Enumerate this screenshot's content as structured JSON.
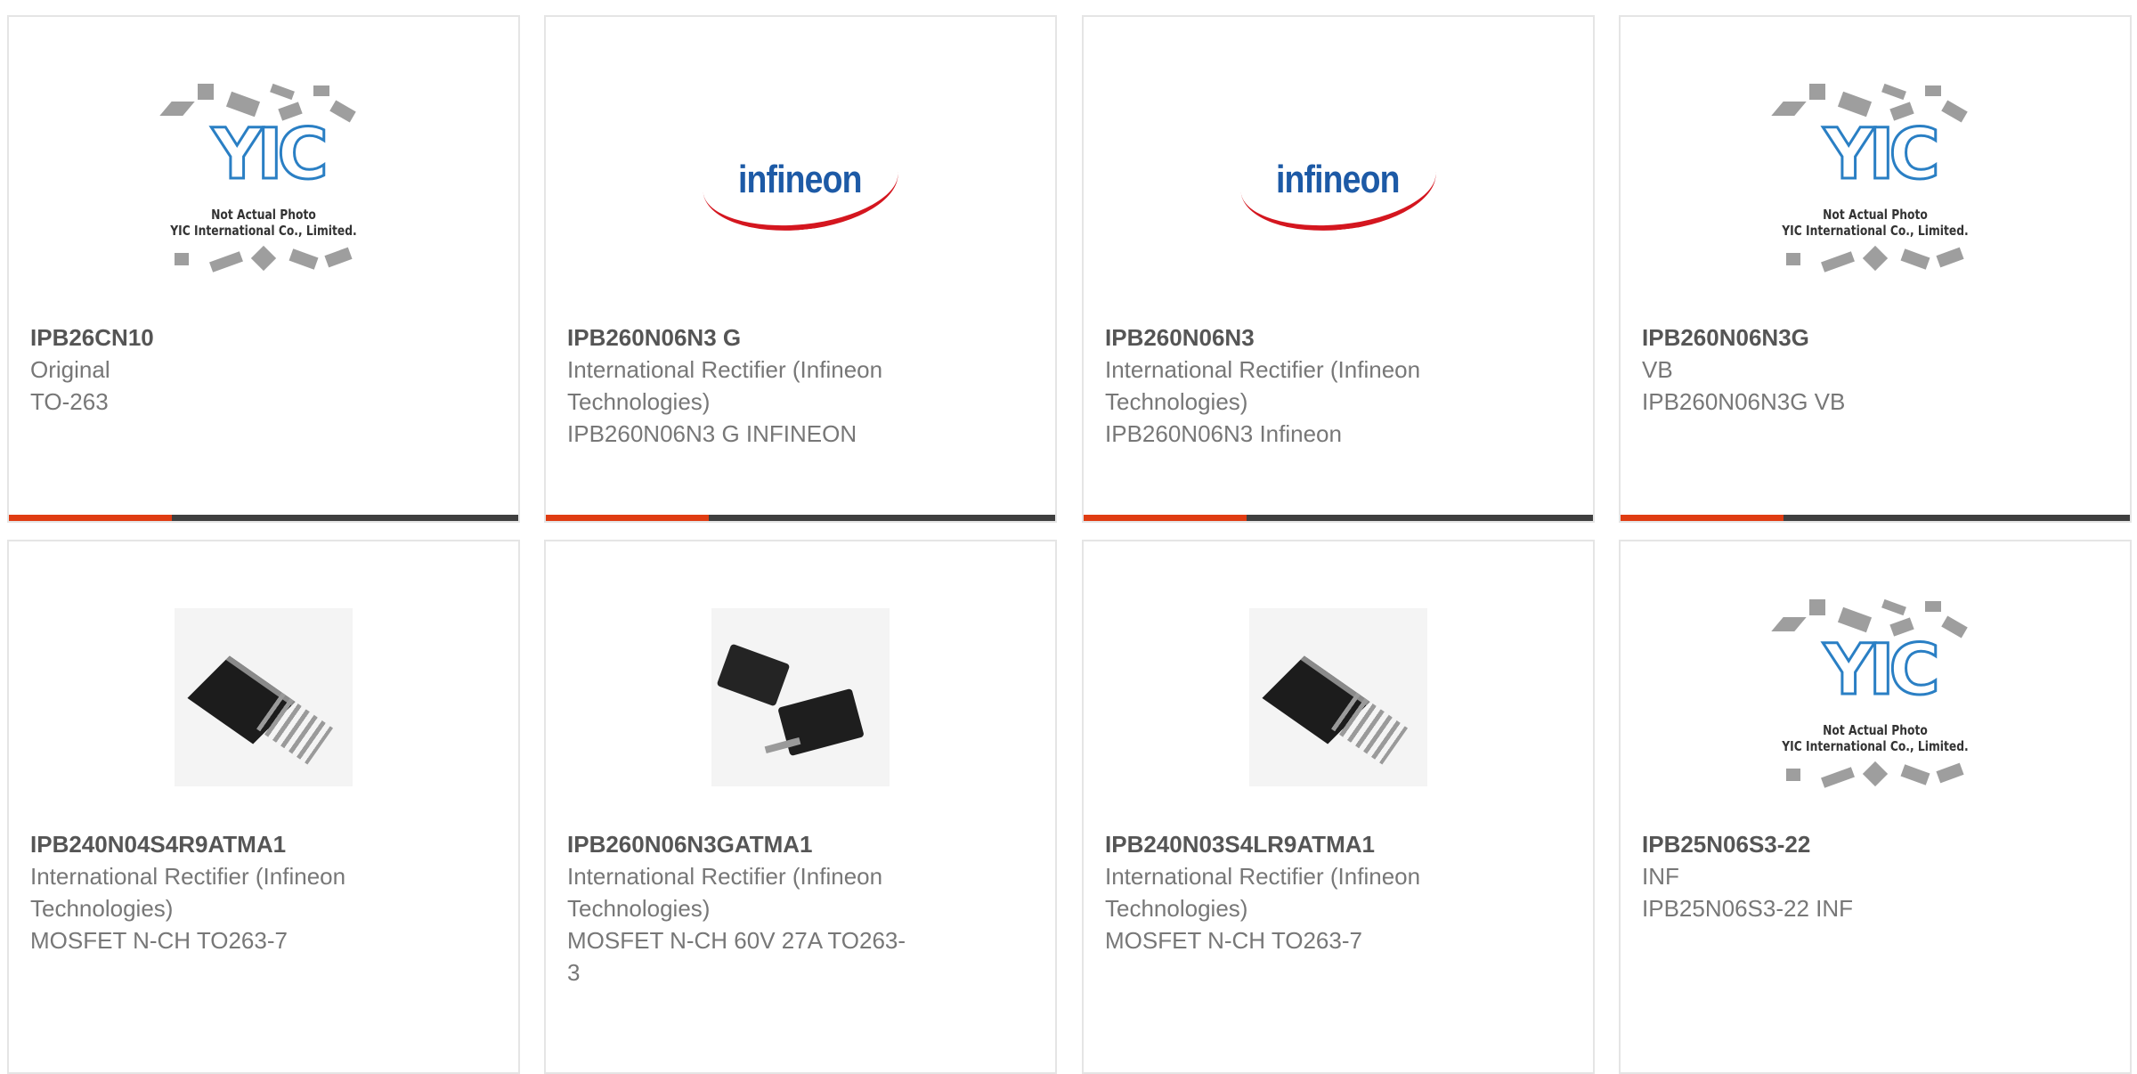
{
  "products": [
    {
      "name": "IPB26CN10",
      "lines": [
        "Original",
        "TO-263"
      ],
      "image": "placeholder"
    },
    {
      "name": "IPB260N06N3 G",
      "lines": [
        "International Rectifier (Infineon",
        "Technologies)",
        "IPB260N06N3 G INFINEON"
      ],
      "image": "infineon-logo"
    },
    {
      "name": "IPB260N06N3",
      "lines": [
        "International Rectifier (Infineon",
        "Technologies)",
        "IPB260N06N3 Infineon"
      ],
      "image": "infineon-logo"
    },
    {
      "name": "IPB260N06N3G",
      "lines": [
        "VB",
        "IPB260N06N3G VB"
      ],
      "image": "placeholder"
    },
    {
      "name": "IPB240N04S4R9ATMA1",
      "lines": [
        "International Rectifier (Infineon",
        "Technologies)",
        "MOSFET N-CH TO263-7"
      ],
      "image": "to263-7-package"
    },
    {
      "name": "IPB260N06N3GATMA1",
      "lines": [
        "International Rectifier (Infineon",
        "Technologies)",
        "MOSFET N-CH 60V 27A TO263-",
        "3"
      ],
      "image": "to263-3-package"
    },
    {
      "name": "IPB240N03S4LR9ATMA1",
      "lines": [
        "International Rectifier (Infineon",
        "Technologies)",
        "MOSFET N-CH TO263-7"
      ],
      "image": "to263-7-package"
    },
    {
      "name": "IPB25N06S3-22",
      "lines": [
        "INF",
        "IPB25N06S3-22 INF"
      ],
      "image": "placeholder"
    }
  ],
  "placeholder": {
    "brand": "YIC",
    "line1": "Not Actual Photo",
    "line2": "YIC International Co., Limited."
  },
  "infineon_logo_text": "infineon",
  "colors": {
    "accent": "#e03c12",
    "bar": "#3f3f3f",
    "border": "#e5e5e5",
    "text": "#777777",
    "title": "#555555"
  }
}
